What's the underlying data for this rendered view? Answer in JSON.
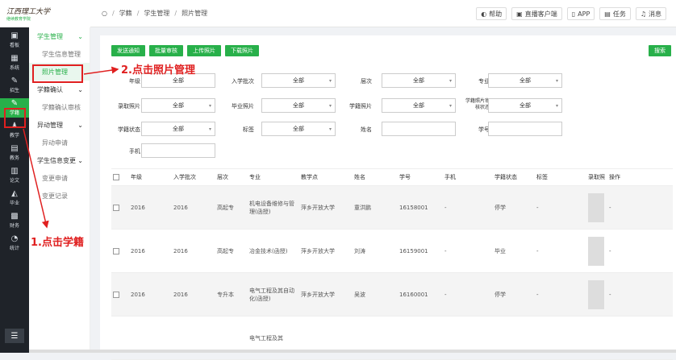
{
  "logo": {
    "text": "江西理工大学",
    "subtitle": "继续教育学院"
  },
  "breadcrumb": {
    "home_icon": "○",
    "items": [
      "学籍",
      "学生管理",
      "照片管理"
    ]
  },
  "toplinks": [
    {
      "icon": "help-icon",
      "glyph": "◐",
      "label": "帮助"
    },
    {
      "icon": "tv-icon",
      "glyph": "▣",
      "label": "直播客户端"
    },
    {
      "icon": "phone-icon",
      "glyph": "▯",
      "label": "APP"
    },
    {
      "icon": "task-icon",
      "glyph": "▤",
      "label": "任务"
    },
    {
      "icon": "bell-icon",
      "glyph": "♫",
      "label": "消息"
    }
  ],
  "leftbar": [
    {
      "label": "看板",
      "glyph": "▣"
    },
    {
      "label": "系统",
      "glyph": "▦"
    },
    {
      "label": "招生",
      "glyph": "✎"
    },
    {
      "label": "学籍",
      "glyph": "✎",
      "active": true
    },
    {
      "label": "教学",
      "glyph": "♟"
    },
    {
      "label": "教务",
      "glyph": "▤"
    },
    {
      "label": "论文",
      "glyph": "▥"
    },
    {
      "label": "毕业",
      "glyph": "◭"
    },
    {
      "label": "财务",
      "glyph": "▩"
    },
    {
      "label": "统计",
      "glyph": "◔"
    }
  ],
  "leftbar_bottom": "☰",
  "sidebar": {
    "groups": [
      {
        "label": "学生管理",
        "items": [
          "学生信息管理",
          "照片管理"
        ]
      },
      {
        "label": "学籍确认",
        "items": [
          "学籍确认审核"
        ]
      },
      {
        "label": "异动管理",
        "items": [
          "异动申请"
        ]
      },
      {
        "label": "学生信息变更",
        "items": [
          "变更申请",
          "变更记录"
        ]
      }
    ]
  },
  "buttons": [
    "发送通知",
    "批量审核",
    "上传照片",
    "下载照片"
  ],
  "search_button": "搜索",
  "filters": {
    "row1": [
      {
        "label": "年级",
        "value": "全部",
        "select": false
      },
      {
        "label": "入学批次",
        "value": "全部",
        "select": true
      },
      {
        "label": "层次",
        "value": "全部",
        "select": true
      },
      {
        "label": "专业",
        "value": "全部",
        "select": true
      }
    ],
    "row2": [
      {
        "label": "录取照片",
        "value": "全部",
        "select": true
      },
      {
        "label": "毕业照片",
        "value": "全部",
        "select": true
      },
      {
        "label": "学籍照片",
        "value": "全部",
        "select": true
      },
      {
        "label": "学籍照片审核状态",
        "value": "全部",
        "select": true
      }
    ],
    "row3": [
      {
        "label": "学籍状态",
        "value": "全部",
        "select": true
      },
      {
        "label": "标签",
        "value": "全部",
        "select": true
      },
      {
        "label": "姓名",
        "value": "",
        "select": false
      },
      {
        "label": "学号",
        "value": "",
        "select": false
      }
    ],
    "row4": [
      {
        "label": "手机",
        "value": "",
        "select": false
      }
    ]
  },
  "table": {
    "headers": [
      "年级",
      "入学批次",
      "层次",
      "专业",
      "教学点",
      "姓名",
      "学号",
      "手机",
      "学籍状态",
      "标签",
      "录取照",
      "操作"
    ],
    "rows": [
      {
        "grade": "2016",
        "batch": "2016",
        "level": "高起专",
        "major": "机电设备维修与管理(函授)",
        "center": "萍乡开放大学",
        "name": "童洪鹏",
        "id": "16158001",
        "phone": "-",
        "status": "停学",
        "tag": "-",
        "op": "-"
      },
      {
        "grade": "2016",
        "batch": "2016",
        "level": "高起专",
        "major": "冶金技术(函授)",
        "center": "萍乡开放大学",
        "name": "刘涛",
        "id": "16159001",
        "phone": "-",
        "status": "毕业",
        "tag": "-",
        "op": "-"
      },
      {
        "grade": "2016",
        "batch": "2016",
        "level": "专升本",
        "major": "电气工程及其自动化(函授)",
        "center": "萍乡开放大学",
        "name": "吴波",
        "id": "16160001",
        "phone": "-",
        "status": "停学",
        "tag": "-",
        "op": "-"
      },
      {
        "grade": "",
        "batch": "",
        "level": "",
        "major": "电气工程及其",
        "center": "",
        "name": "",
        "id": "",
        "phone": "",
        "status": "",
        "tag": "",
        "op": ""
      }
    ]
  },
  "annotations": {
    "step1": "1.点击学籍",
    "step2": "2.点击照片管理"
  }
}
